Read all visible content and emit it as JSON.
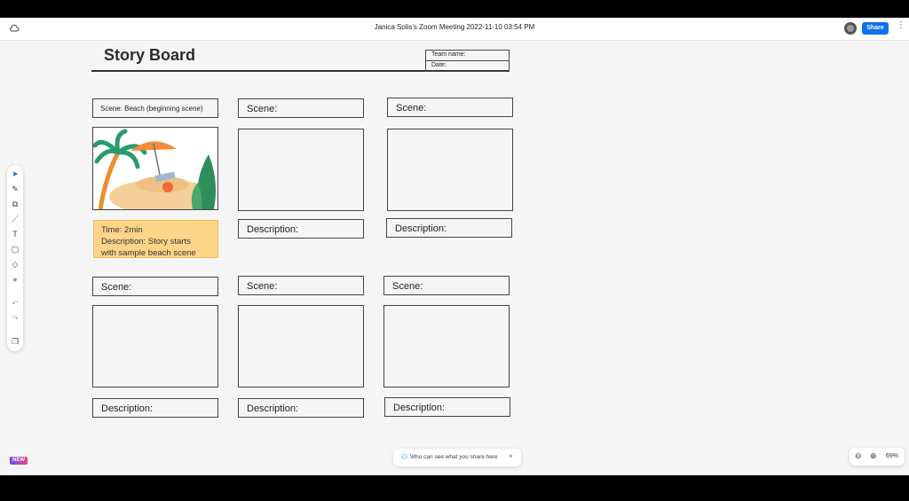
{
  "window": {
    "title": "Janica Solis's Zoom Meeting 2022-11-10 03:54 PM",
    "share_label": "Share",
    "more_label": "⋮"
  },
  "board": {
    "title": "Story Board",
    "team_label": "Team name:",
    "date_label": "Date:"
  },
  "scenes_row1": [
    {
      "scene": "Scene: Beach (beginning scene)",
      "description": "Description:"
    },
    {
      "scene": "Scene:",
      "description": "Description:"
    },
    {
      "scene": "Scene:",
      "description": "Description:"
    }
  ],
  "note": {
    "time": "Time: 2min",
    "line1": "Description: Story starts",
    "line2": "with sample beach scene"
  },
  "scenes_row2": [
    {
      "scene": "Scene:",
      "description": "Description:"
    },
    {
      "scene": "Scene:",
      "description": "Description:"
    },
    {
      "scene": "Scene:",
      "description": "Description:"
    }
  ],
  "toolbar": {
    "tools": [
      "select-icon",
      "pen-icon",
      "shapes-icon",
      "line-icon",
      "text-icon",
      "sticky-note-icon",
      "eraser-icon",
      "color-icon",
      "undo-icon",
      "redo-icon",
      "pages-icon"
    ],
    "glyphs": [
      "➤",
      "✎",
      "⧉",
      "／",
      "T",
      "▢",
      "◇",
      "●",
      "↶",
      "↷",
      "❐"
    ]
  },
  "footer": {
    "new_badge": "NEW",
    "who_text": "Who can see what you share here",
    "close_glyph": "×",
    "zoom_level": "69%",
    "zoom_out_glyph": "⊖",
    "zoom_in_glyph": "⊕"
  },
  "colors": {
    "accent": "#0e71eb",
    "note_fill": "#fcd588"
  }
}
